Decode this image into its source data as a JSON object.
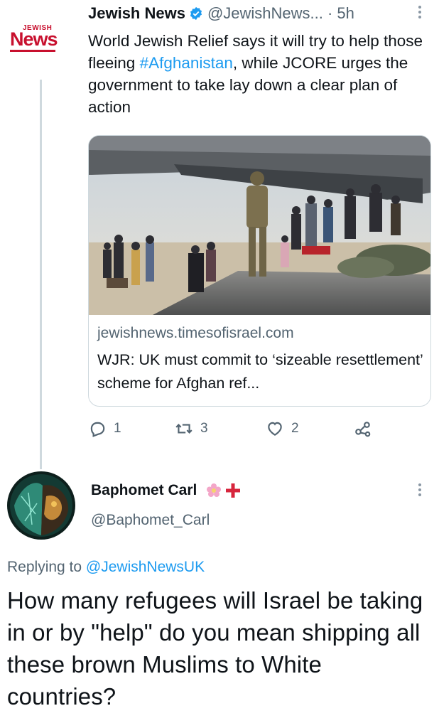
{
  "tweet": {
    "author_name": "Jewish News",
    "handle_time": "@JewishNews... · 5h",
    "logo": {
      "small": "JEWISH",
      "big": "News"
    },
    "text_before_hashtag": "World Jewish Relief says it will try to help those fleeing ",
    "hashtag": "#Afghanistan",
    "text_after_hashtag": ", while JCORE urges the government to take lay down a clear plan of action",
    "card": {
      "domain": "jewishnews.timesofisrael.com",
      "title": "WJR: UK must commit to ‘sizeable resettlement’ scheme for Afghan ref..."
    },
    "actions": {
      "replies": "1",
      "retweets": "3",
      "likes": "2"
    },
    "icons": [
      "verified-icon",
      "more-icon",
      "reply-icon",
      "retweet-icon",
      "like-icon",
      "share-icon"
    ]
  },
  "reply": {
    "author_name": "Baphomet Carl",
    "handle": "@Baphomet_Carl",
    "replying_prefix": "Replying to ",
    "replying_mention": "@JewishNewsUK",
    "text": "How many refugees will Israel be taking in or by \"help\" do you mean shipping all these brown Muslims to White countries?"
  },
  "colors": {
    "accent": "#1d9bf0",
    "muted": "#536471",
    "logo_red": "#c8102e",
    "border": "#cfd9de"
  }
}
